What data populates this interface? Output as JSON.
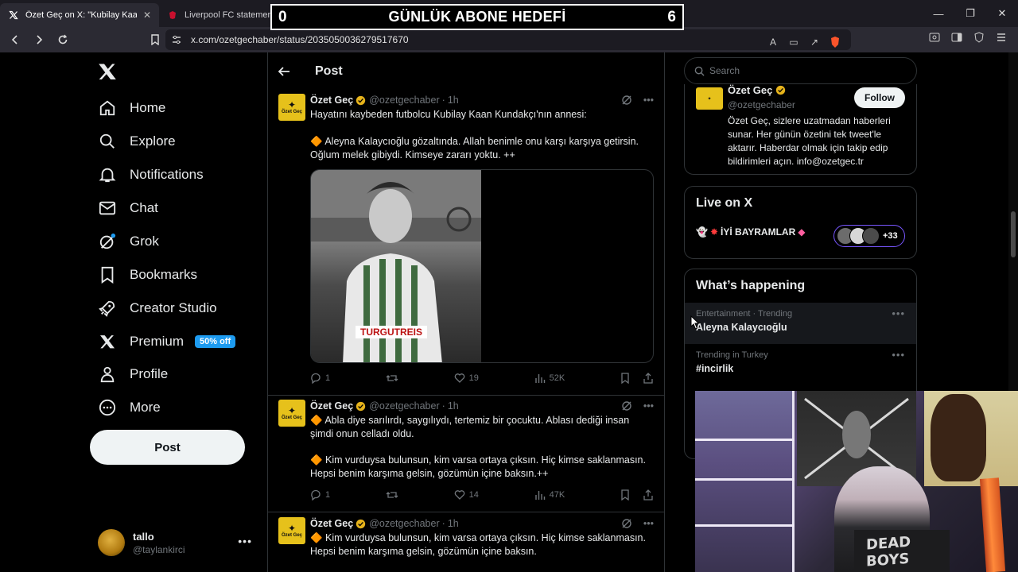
{
  "browser": {
    "tabs": [
      {
        "title": "Özet Geç on X: \"Kubilay Kaan Ku",
        "favicon": "x-icon",
        "active": true
      },
      {
        "title": "Liverpool FC statement - Liverpool FC",
        "favicon": "liverpool-icon",
        "active": false
      }
    ],
    "url": "x.com/ozetgechaber/status/2035050036279517670"
  },
  "overlay": {
    "left_count": "0",
    "label": "GÜNLÜK ABONE HEDEFİ",
    "right_count": "6"
  },
  "nav": {
    "items": [
      {
        "label": "Home",
        "icon": "home-icon"
      },
      {
        "label": "Explore",
        "icon": "search-icon"
      },
      {
        "label": "Notifications",
        "icon": "bell-icon"
      },
      {
        "label": "Chat",
        "icon": "mail-icon"
      },
      {
        "label": "Grok",
        "icon": "grok-icon"
      },
      {
        "label": "Bookmarks",
        "icon": "bookmark-icon"
      },
      {
        "label": "Creator Studio",
        "icon": "rocket-icon"
      },
      {
        "label": "Premium",
        "icon": "x-icon"
      },
      {
        "label": "Profile",
        "icon": "person-icon"
      },
      {
        "label": "More",
        "icon": "more-circle-icon"
      }
    ],
    "premium_badge": "50% off",
    "post_button": "Post",
    "account": {
      "display_name": "tallo",
      "handle": "@taylankirci"
    }
  },
  "main": {
    "header_title": "Post",
    "tweets": [
      {
        "name": "Özet Geç",
        "handle": "@ozetgechaber",
        "time": "1h",
        "text_line1": "Hayatını kaybeden futbolcu Kubilay Kaan Kundakçı'nın annesi:",
        "text_line2": "🔶 Aleyna Kalaycıoğlu gözaltında. Allah benimle onu karşı karşıya getirsin. Oğlum melek gibiydi. Kimseye zararı yoktu. ++",
        "media_sponsor": "TURGUTREIS",
        "replies": "1",
        "likes": "19",
        "views": "52K"
      },
      {
        "name": "Özet Geç",
        "handle": "@ozetgechaber",
        "time": "1h",
        "text_line1": "🔶 Abla diye sarılırdı, saygılıydı, tertemiz bir çocuktu. Ablası dediği insan şimdi onun celladı oldu.",
        "text_line2": "🔶 Kim vurduysa bulunsun, kim varsa ortaya çıksın. Hiç kimse saklanmasın. Hepsi benim karşıma gelsin, gözümün içine baksın.++",
        "replies": "1",
        "likes": "14",
        "views": "47K"
      },
      {
        "name": "Özet Geç",
        "handle": "@ozetgechaber",
        "time": "1h",
        "text_line1": "🔶 Kim vurduysa bulunsun, kim varsa ortaya çıksın. Hiç kimse saklanmasın. Hepsi benim karşıma gelsin, gözümün içine baksın."
      }
    ]
  },
  "right": {
    "search_placeholder": "Search",
    "profile": {
      "name": "Özet Geç",
      "handle": "@ozetgechaber",
      "follow_label": "Follow",
      "bio": "Özet Geç, sizlere uzatmadan haberleri sunar. Her günün özetini tek tweet'le aktarır. Haberdar olmak için takip edip bildirimleri açın. info@ozetgec.tr"
    },
    "live": {
      "title": "Live on X",
      "broadcast": "İYİ BAYRAMLAR",
      "count": "+33"
    },
    "happening": {
      "title": "What’s happening",
      "trends": [
        {
          "meta": "Entertainment · Trending",
          "name": "Aleyna Kalaycıoğlu"
        },
        {
          "meta": "Trending in Turkey",
          "name": "#incirlik"
        }
      ]
    }
  },
  "webcam": {
    "shirt_text": "DEAD BOYS"
  },
  "colors": {
    "accent": "#1d9bf0",
    "background": "#000000",
    "border": "#2f3336",
    "muted": "#71767b",
    "live_border": "#7856ff"
  }
}
